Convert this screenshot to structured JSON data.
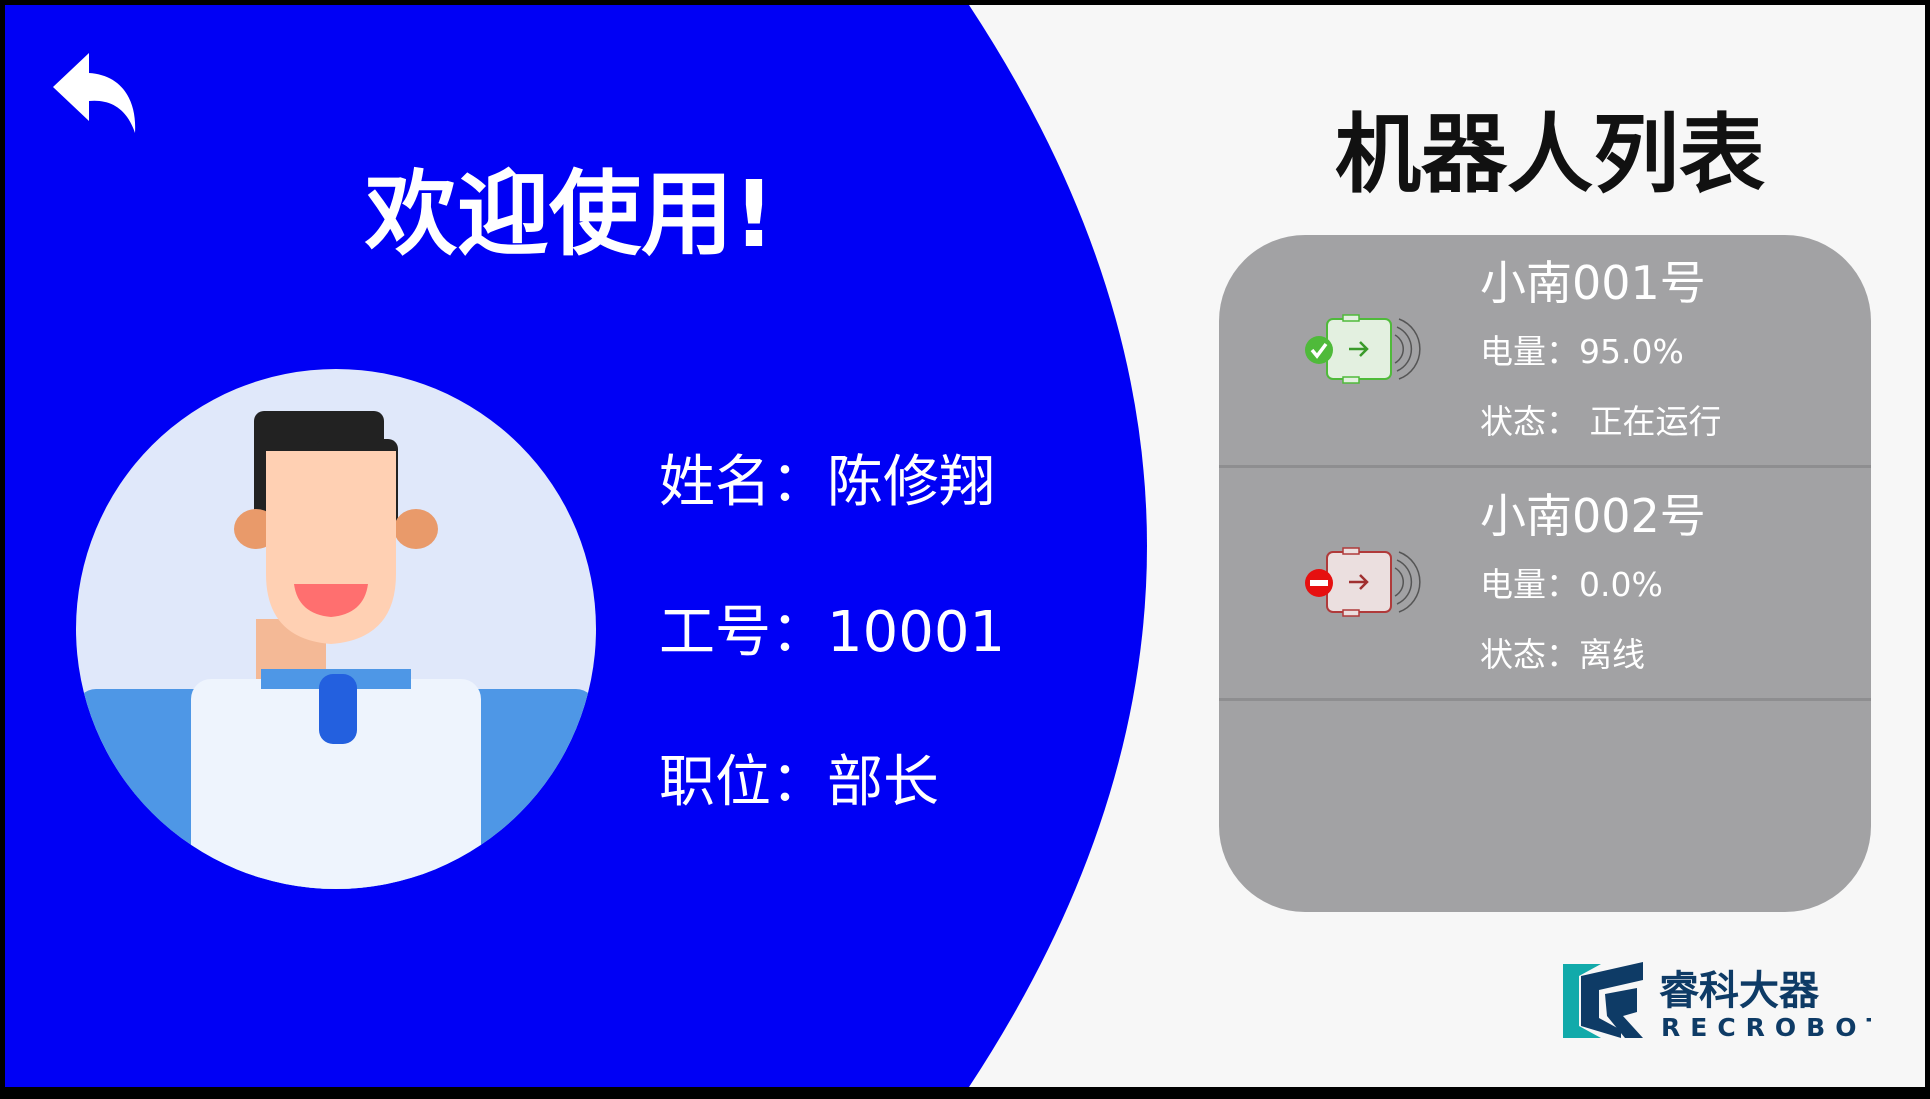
{
  "left": {
    "welcome": "欢迎使用!",
    "name_label": "姓名：",
    "name": "陈修翔",
    "id_label": "工号：",
    "id": "10001",
    "position_label": "职位：",
    "position": "部长"
  },
  "right": {
    "title": "机器人列表",
    "robots": [
      {
        "name": "小南001号",
        "battery_label": "电量：",
        "battery": "95.0%",
        "status_label": "状态：",
        "status": " 正在运行",
        "state": "online"
      },
      {
        "name": "小南002号",
        "battery_label": "电量：",
        "battery": "0.0%",
        "status_label": "状态：",
        "status": "离线",
        "state": "offline"
      }
    ]
  },
  "logo": {
    "cn": "睿科大器",
    "en": "RECROBOT"
  },
  "colors": {
    "primary": "#0000f5",
    "card": "#a2a2a4",
    "online": "#4fba3a",
    "offline": "#e61010"
  }
}
